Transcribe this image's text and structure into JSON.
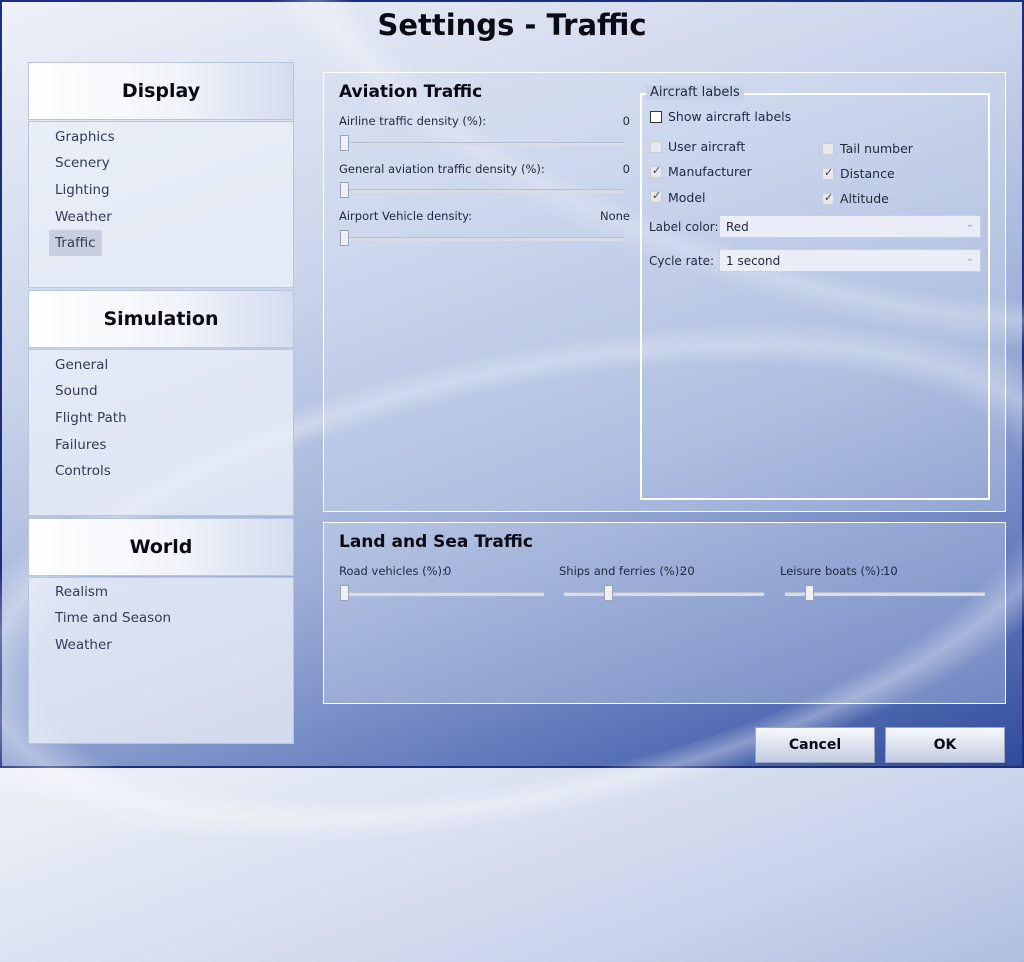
{
  "title": "Settings - Traffic",
  "sidebar": {
    "sections": [
      {
        "header": "Display",
        "items": [
          "Graphics",
          "Scenery",
          "Lighting",
          "Weather",
          "Traffic"
        ]
      },
      {
        "header": "Simulation",
        "items": [
          "General",
          "Sound",
          "Flight Path",
          "Failures",
          "Controls"
        ]
      },
      {
        "header": "World",
        "items": [
          "Realism",
          "Time and Season",
          "Weather"
        ]
      }
    ],
    "selected": "Traffic"
  },
  "aviation": {
    "title": "Aviation Traffic",
    "airline_label": "Airline traffic density (%):",
    "airline_value": "0",
    "airline_level": 0,
    "ga_label": "General aviation traffic density (%):",
    "ga_value": "0",
    "ga_level": 0,
    "vehicle_label": "Airport Vehicle density:",
    "vehicle_value": "None",
    "vehicle_level": 0
  },
  "labels": {
    "title": "Aircraft labels",
    "show_label": "Show aircraft labels",
    "show_checked": false,
    "user_aircraft": "User aircraft",
    "tail_number": "Tail number",
    "manufacturer": "Manufacturer",
    "distance": "Distance",
    "model": "Model",
    "altitude": "Altitude",
    "color_label": "Label color:",
    "color_value": "Red",
    "cycle_label": "Cycle rate:",
    "cycle_value": "1 second"
  },
  "landsea": {
    "title": "Land and Sea Traffic",
    "road_label": "Road vehicles (%):",
    "road_value": "0",
    "road_level": 0,
    "ships_label": "Ships and ferries (%):",
    "ships_value": "20",
    "ships_level": 20,
    "leisure_label": "Leisure boats (%):",
    "leisure_value": "10",
    "leisure_level": 10
  },
  "buttons": {
    "cancel": "Cancel",
    "ok": "OK"
  },
  "icons": {
    "check": "checkmark-icon",
    "chevron": "chevron-down-icon"
  }
}
